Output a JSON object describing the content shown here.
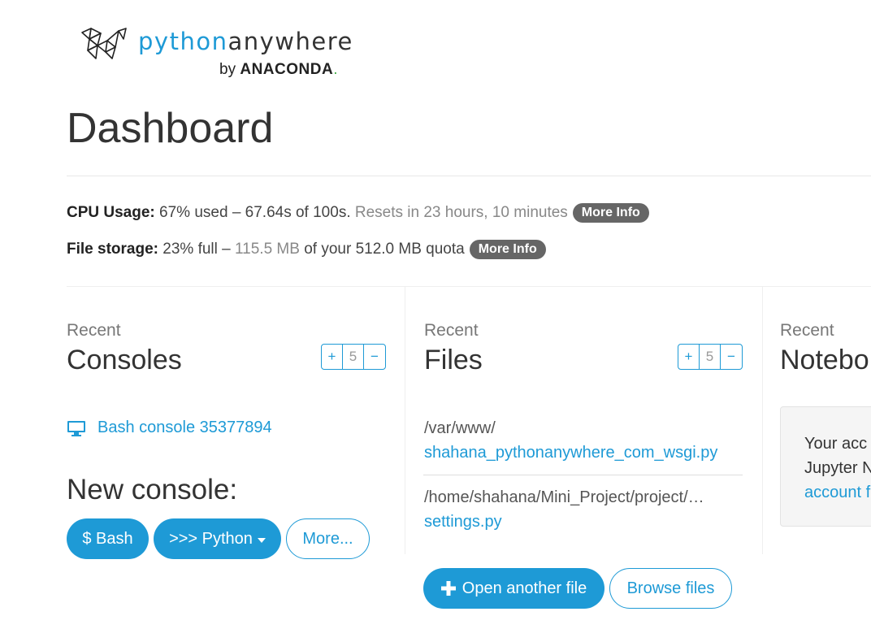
{
  "logo": {
    "brand_part1": "python",
    "brand_part2": "anywhere",
    "by": "by",
    "vendor": "ANACONDA",
    "vendor_dot": ".",
    "mark_icon": "pythonanywhere-snake-logo-icon"
  },
  "page_title": "Dashboard",
  "usage": {
    "cpu_label": "CPU Usage:",
    "cpu_value": "67% used – 67.64s of 100s.",
    "cpu_reset": "Resets in 23 hours, 10 minutes",
    "cpu_more": "More Info",
    "storage_label": "File storage:",
    "storage_value1": "23% full –",
    "storage_used": "115.5 MB",
    "storage_value2": "of your 512.0 MB quota",
    "storage_more": "More Info"
  },
  "consoles": {
    "kicker": "Recent",
    "title": "Consoles",
    "stepper": {
      "plus": "+",
      "count": "5",
      "minus": "−"
    },
    "items": [
      {
        "label": "Bash console 35377894",
        "icon": "monitor-icon"
      }
    ],
    "new_console_title": "New console:",
    "buttons": {
      "bash": "$ Bash",
      "python": ">>> Python",
      "more": "More..."
    }
  },
  "files": {
    "kicker": "Recent",
    "title": "Files",
    "stepper": {
      "plus": "+",
      "count": "5",
      "minus": "−"
    },
    "items": [
      {
        "path": "/var/www/",
        "name": "shahana_pythonanywhere_com_wsgi.py"
      },
      {
        "path": "/home/shahana/Mini_Project/project/…",
        "name": "settings.py"
      }
    ],
    "open_button": "Open another file",
    "browse_button": "Browse files"
  },
  "notebooks": {
    "kicker": "Recent",
    "title": "Notebo",
    "box_line1": "Your acc",
    "box_line2": "Jupyter N",
    "box_link": "account f"
  },
  "colors": {
    "accent": "#1e9ad6",
    "pill": "#666666",
    "text": "#333333"
  }
}
